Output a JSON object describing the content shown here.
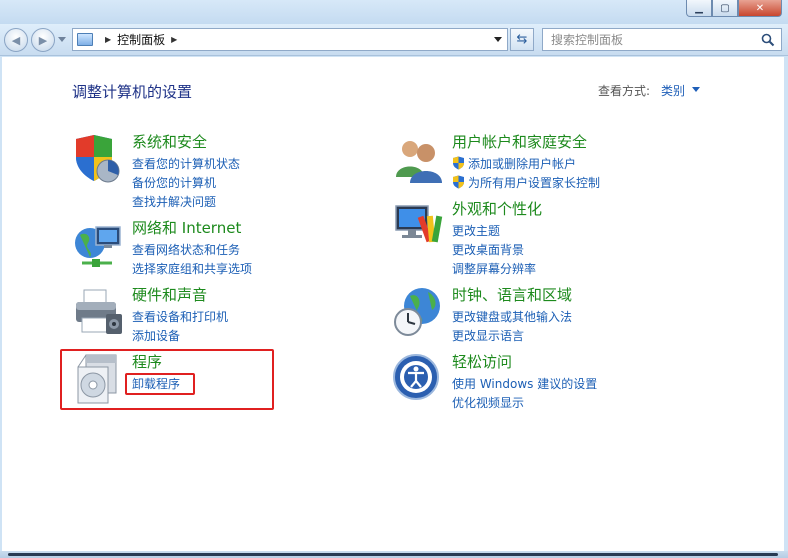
{
  "nav": {
    "address_items": [
      "控制面板"
    ],
    "search_placeholder": "搜索控制面板"
  },
  "page": {
    "title": "调整计算机的设置",
    "view_by_label": "查看方式:",
    "view_by_value": "类别"
  },
  "left_categories": [
    {
      "title": "系统和安全",
      "icon": "shield-pie-icon",
      "links": [
        "查看您的计算机状态",
        "备份您的计算机",
        "查找并解决问题"
      ]
    },
    {
      "title": "网络和 Internet",
      "icon": "network-globe-icon",
      "links": [
        "查看网络状态和任务",
        "选择家庭组和共享选项"
      ]
    },
    {
      "title": "硬件和声音",
      "icon": "printer-icon",
      "links": [
        "查看设备和打印机",
        "添加设备"
      ]
    },
    {
      "title": "程序",
      "icon": "programs-disc-icon",
      "links": [
        "卸载程序"
      ]
    }
  ],
  "right_categories": [
    {
      "title": "用户帐户和家庭安全",
      "icon": "users-icon",
      "links": [
        "添加或删除用户帐户",
        "为所有用户设置家长控制"
      ]
    },
    {
      "title": "外观和个性化",
      "icon": "monitor-palette-icon",
      "links": [
        "更改主题",
        "更改桌面背景",
        "调整屏幕分辨率"
      ]
    },
    {
      "title": "时钟、语言和区域",
      "icon": "clock-globe-icon",
      "links": [
        "更改键盘或其他输入法",
        "更改显示语言"
      ]
    },
    {
      "title": "轻松访问",
      "icon": "ease-of-access-icon",
      "links": [
        "使用 Windows 建议的设置",
        "优化视频显示"
      ]
    }
  ],
  "colors": {
    "category_title": "#1d8a1d",
    "link": "#1c5fb5",
    "page_title": "#1e3287",
    "highlight": "#e02020"
  }
}
